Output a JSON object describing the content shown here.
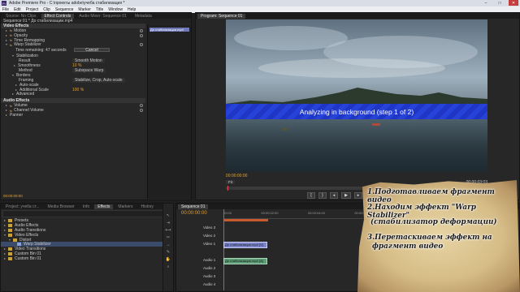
{
  "window": {
    "title": "Adobe Premiere Pro - C:\\проекты adobe\\учеба стабилизация *",
    "app_icon": "Pr"
  },
  "menu": [
    "File",
    "Edit",
    "Project",
    "Clip",
    "Sequence",
    "Marker",
    "Title",
    "Window",
    "Help"
  ],
  "effect_controls": {
    "tabs": [
      "Source: No Clips",
      "Effect Controls",
      "Audio Mixer: Sequence 01",
      "Metadata"
    ],
    "clip_tab": "Sequence 01 * До стабилизации.mp4",
    "mini_timeline_label": "До стабилизации.mp4",
    "video_effects_label": "Video Effects",
    "effects": [
      "Motion",
      "Opacity",
      "Time Remapping",
      "Warp Stabilizer"
    ],
    "warp": {
      "time_remaining_label": "Time remaining: 47 seconds",
      "cancel_label": "Cancel",
      "stabilization_label": "Stabilization",
      "result_label": "Result",
      "result_value": "Smooth Motion",
      "smoothness_label": "Smoothness",
      "smoothness_value": "10 %",
      "method_label": "Method",
      "method_value": "Subspace Warp",
      "borders_label": "Borders",
      "framing_label": "Framing",
      "framing_value": "Stabilize, Crop, Auto-scale",
      "autoscale_label": "Auto-scale",
      "additional_scale_label": "Additional Scale",
      "additional_scale_value": "100 %",
      "advanced_label": "Advanced"
    },
    "audio_effects_label": "Audio Effects",
    "audio_effects": [
      "Volume",
      "Channel Volume",
      "Panner"
    ],
    "timecode": "00:00:00:00"
  },
  "program": {
    "tab": "Program: Sequence 01",
    "overlay_text": "Analyzing in background (step 1 of 2)",
    "timecode_left": "00:00:00:00",
    "zoom": "Fit",
    "timecode_right": "00:00:03:03"
  },
  "project": {
    "tabs": [
      "Project: учеба ст...",
      "Media Browser",
      "Info",
      "Effects",
      "Markers",
      "History"
    ],
    "tree": [
      "Presets",
      "Audio Effects",
      "Audio Transitions",
      "Video Effects",
      "Distort",
      "Warp Stabilizer",
      "Video Transitions",
      "Custom Bin 01",
      "Custom Bin 01"
    ]
  },
  "timeline": {
    "tab": "Sequence 01",
    "timecode": "00:00:00:00",
    "ruler": [
      "00:00",
      "00:00:02:00",
      "00:00:04:00",
      "00:00:06:00",
      "00:00:08:00"
    ],
    "video_tracks": [
      "Video 3",
      "Video 2",
      "Video 1"
    ],
    "audio_tracks": [
      "Audio 1",
      "Audio 2",
      "Audio 3",
      "Audio 4"
    ],
    "video_clip": "До стабилизации.mp4 [V]",
    "audio_clip": "До стабилизации.mp4 [A]",
    "master": "Master"
  },
  "instructions": [
    "1.Подготавливаем фрагмент видео",
    "2.Находим эффект \"Warp Stabilizer\"",
    "(стабилизатор деформации)",
    "3.Перетаскиваем эффект на",
    "фрагмент видео"
  ]
}
